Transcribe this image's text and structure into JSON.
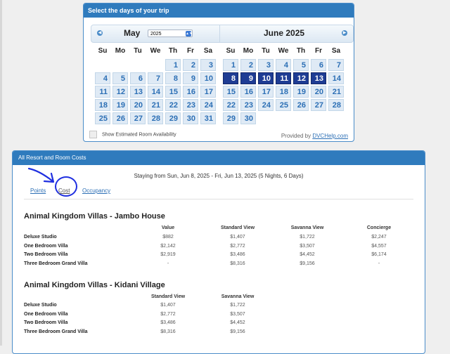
{
  "calendar": {
    "header": "Select the days of your trip",
    "left_month": "May",
    "year_select": "2025",
    "right_month": "June 2025",
    "weekdays": [
      "Su",
      "Mo",
      "Tu",
      "We",
      "Th",
      "Fr",
      "Sa"
    ],
    "may_days": [
      "1",
      "2",
      "3",
      "4",
      "5",
      "6",
      "7",
      "8",
      "9",
      "10",
      "11",
      "12",
      "13",
      "14",
      "15",
      "16",
      "17",
      "18",
      "19",
      "20",
      "21",
      "22",
      "23",
      "24",
      "25",
      "26",
      "27",
      "28",
      "29",
      "30",
      "31"
    ],
    "june_days": [
      "1",
      "2",
      "3",
      "4",
      "5",
      "6",
      "7",
      "8",
      "9",
      "10",
      "11",
      "12",
      "13",
      "14",
      "15",
      "16",
      "17",
      "18",
      "19",
      "20",
      "21",
      "22",
      "23",
      "24",
      "25",
      "26",
      "27",
      "28",
      "29",
      "30"
    ],
    "selected_june": [
      "8",
      "9",
      "10",
      "11",
      "12",
      "13"
    ],
    "availability_label": "Show Estimated Room Availability",
    "provided_by": "Provided by",
    "provider_link": "DVCHelp.com"
  },
  "costs": {
    "header": "All Resort and Room Costs",
    "staying": "Staying from Sun, Jun 8, 2025 - Fri, Jun 13, 2025 (5 Nights, 6 Days)",
    "tabs": [
      "Points",
      "Cost",
      "Occupancy"
    ],
    "resorts": [
      {
        "name": "Animal Kingdom Villas - Jambo House",
        "columns": [
          "Value",
          "Standard View",
          "Savanna View",
          "Concierge"
        ],
        "rows": [
          {
            "label": "Deluxe Studio",
            "values": [
              "$882",
              "$1,407",
              "$1,722",
              "$2,247"
            ]
          },
          {
            "label": "One Bedroom Villa",
            "values": [
              "$2,142",
              "$2,772",
              "$3,507",
              "$4,557"
            ]
          },
          {
            "label": "Two Bedroom Villa",
            "values": [
              "$2,919",
              "$3,486",
              "$4,452",
              "$6,174"
            ]
          },
          {
            "label": "Three Bedroom Grand Villa",
            "values": [
              "-",
              "$8,316",
              "$9,156",
              "-"
            ]
          }
        ]
      },
      {
        "name": "Animal Kingdom Villas - Kidani Village",
        "columns": [
          "Standard View",
          "Savanna View"
        ],
        "rows": [
          {
            "label": "Deluxe Studio",
            "values": [
              "$1,407",
              "$1,722"
            ]
          },
          {
            "label": "One Bedroom Villa",
            "values": [
              "$2,772",
              "$3,507"
            ]
          },
          {
            "label": "Two Bedroom Villa",
            "values": [
              "$3,486",
              "$4,452"
            ]
          },
          {
            "label": "Three Bedroom Grand Villa",
            "values": [
              "$8,316",
              "$9,156"
            ]
          }
        ]
      }
    ]
  },
  "colors": {
    "header_blue": "#2f7bbd",
    "selected_day": "#1e3c94",
    "annotation_blue": "#1f2fe0"
  }
}
